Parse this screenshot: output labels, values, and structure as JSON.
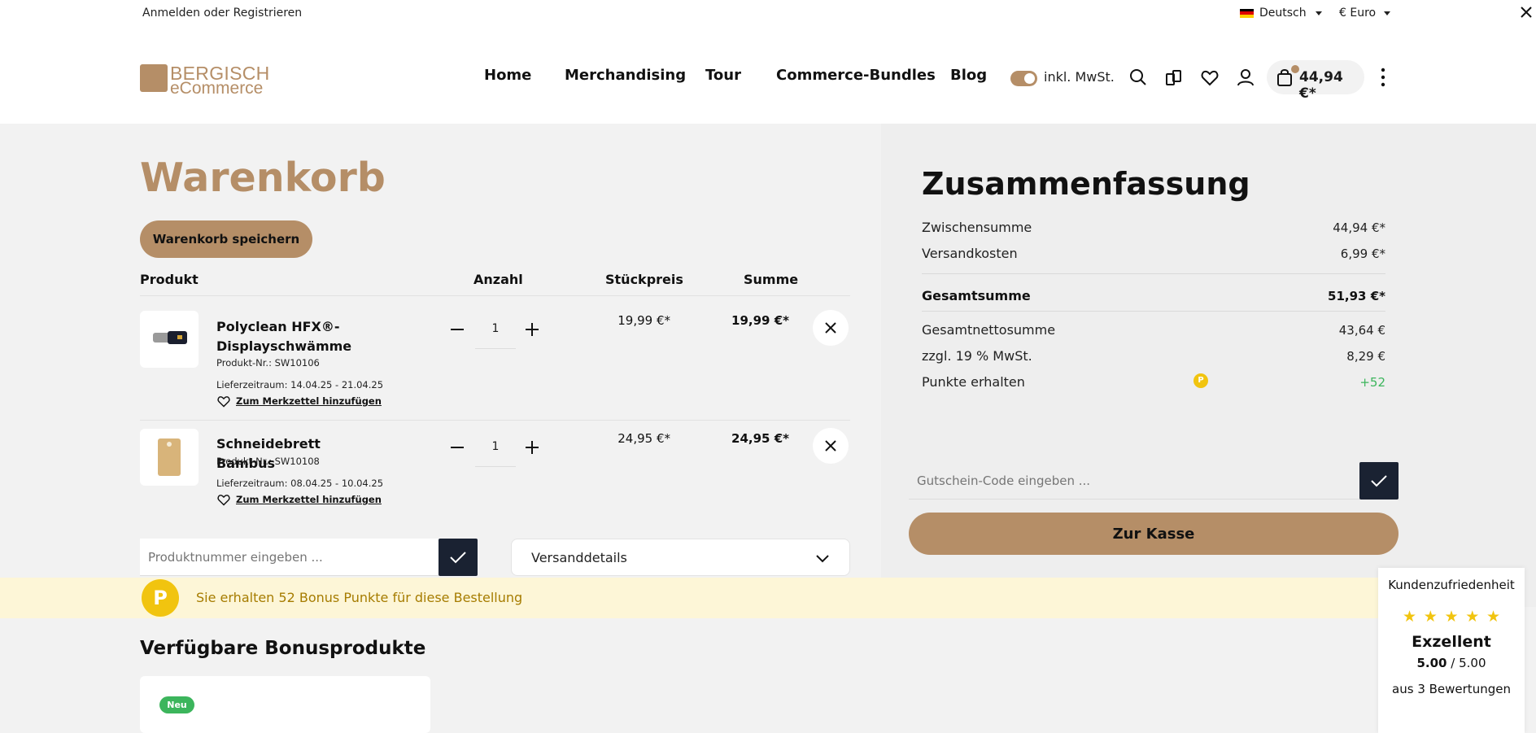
{
  "topbar": {
    "login_label": "Anmelden oder Registrieren",
    "language": "Deutsch",
    "currency": "€ Euro"
  },
  "header": {
    "logo_line1": "BERGISCH",
    "logo_line2": "eCommerce",
    "nav": [
      "Home",
      "Merchandising",
      "Tour",
      "Commerce-Bundles",
      "Blog"
    ],
    "tax_toggle_label": "inkl. MwSt.",
    "cart_total": "44,94 €*",
    "icons": [
      "search-icon",
      "compare-icon",
      "heart-icon",
      "user-icon",
      "bag-icon",
      "more-vertical-icon"
    ]
  },
  "cart": {
    "title": "Warenkorb",
    "save_button": "Warenkorb speichern",
    "columns": {
      "product": "Produkt",
      "quantity": "Anzahl",
      "unit_price": "Stückpreis",
      "total": "Summe"
    },
    "items": [
      {
        "name": "Polyclean HFX®-Displayschwämme",
        "sku": "Produkt-Nr.: SW10106",
        "delivery": "Lieferzeitraum: 14.04.25 - 21.04.25",
        "wishlist": "Zum Merkzettel hinzufügen",
        "quantity": "1",
        "unit_price": "19,99 €*",
        "total": "19,99 €*"
      },
      {
        "name": "Schneidebrett Bambus",
        "sku": "Produkt-Nr.: SW10108",
        "delivery": "Lieferzeitraum: 08.04.25 - 10.04.25",
        "wishlist": "Zum Merkzettel hinzufügen",
        "quantity": "1",
        "unit_price": "24,95 €*",
        "total": "24,95 €*"
      }
    ],
    "product_number_placeholder": "Produktnummer eingeben ...",
    "shipping_details": "Versanddetails"
  },
  "bonus": {
    "badge": "P",
    "message": "Sie erhalten 52 Bonus Punkte für diese Bestellung",
    "title": "Verfügbare Bonusprodukte",
    "new_badge": "Neu"
  },
  "summary": {
    "title": "Zusammenfassung",
    "subtotal_label": "Zwischensumme",
    "subtotal": "44,94 €*",
    "shipping_label": "Versandkosten",
    "shipping": "6,99 €*",
    "grand_total_label": "Gesamtsumme",
    "grand_total": "51,93 €*",
    "net_total_label": "Gesamtnettosumme",
    "net_total": "43,64 €",
    "vat_label": "zzgl. 19 % MwSt.",
    "vat": "8,29 €",
    "points_label": "Punkte erhalten",
    "points_badge": "P",
    "points": "+52",
    "coupon_placeholder": "Gutschein-Code eingeben ...",
    "checkout_button": "Zur Kasse"
  },
  "review_widget": {
    "title": "Kundenzufriedenheit",
    "rating_label": "Exzellent",
    "score": "5.00",
    "max": "5.00",
    "count": "aus 3 Bewertungen",
    "stars": 5
  },
  "colors": {
    "accent": "#b58e67",
    "dark_button": "#1a2232",
    "bonus_yellow": "#f1c40f",
    "bonus_bar": "#fdf6d7",
    "success_green": "#3cb55c"
  }
}
